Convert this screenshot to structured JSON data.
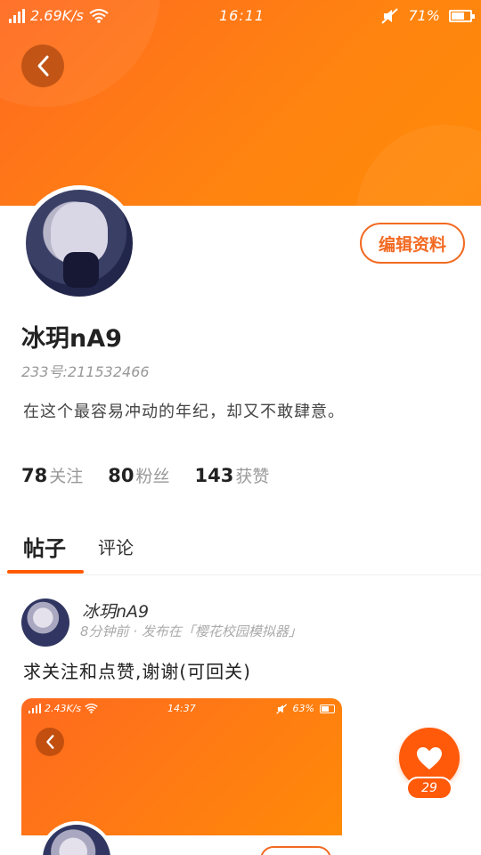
{
  "status_bar": {
    "speed": "2.69K/s",
    "time": "16:11",
    "battery": "71%",
    "battery_level": 0.71
  },
  "profile": {
    "username": "冰玥nA9",
    "uid": "233号:211532466",
    "bio": "在这个最容易冲动的年纪，却又不敢肆意。",
    "edit_label": "编辑资料"
  },
  "stats": [
    {
      "num": "78",
      "label": "关注"
    },
    {
      "num": "80",
      "label": "粉丝"
    },
    {
      "num": "143",
      "label": "获赞"
    }
  ],
  "tabs": [
    {
      "label": "帖子"
    },
    {
      "label": "评论"
    }
  ],
  "post": {
    "author": "冰玥nA9",
    "meta": "8分钟前 · 发布在「樱花校园模拟器」",
    "text": "求关注和点赞,谢谢(可回关)",
    "image_status": {
      "speed": "2.43K/s",
      "time": "14:37",
      "battery": "63%"
    }
  },
  "like": {
    "count": "29"
  },
  "colors": {
    "accent": "#ff5a00",
    "header": "#ff7a14"
  }
}
